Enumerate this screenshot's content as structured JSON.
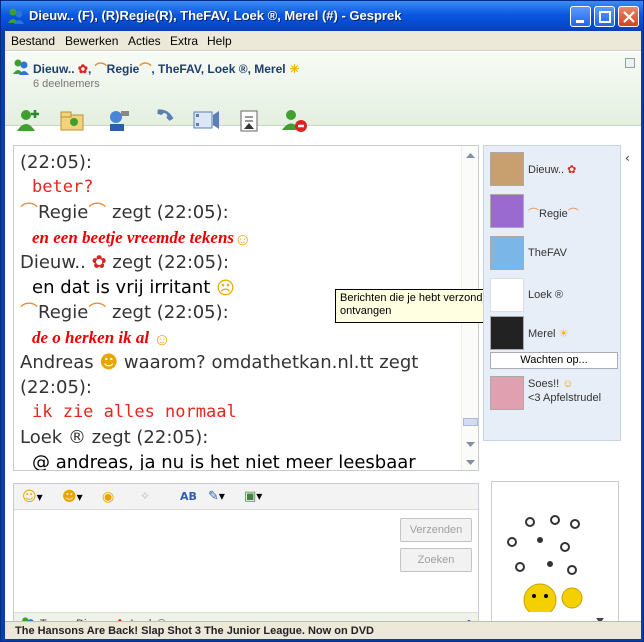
{
  "window": {
    "title": "Dieuw.. (F), (R)Regie(R), TheFAV, Loek ®, Merel (#) - Gesprek"
  },
  "menu": [
    "Bestand",
    "Bewerken",
    "Acties",
    "Extra",
    "Help"
  ],
  "participants": {
    "names_a": "Dieuw..",
    "names_b": ",",
    "names_c": "Regie",
    "names_d": ", TheFAV, Loek ®, Merel",
    "count": "6 deelnemers"
  },
  "toolbar": {
    "icons": [
      "add-contact-icon",
      "share-files-icon",
      "video-call-icon",
      "phone-icon",
      "games-icon",
      "send-picture-icon",
      "block-icon"
    ]
  },
  "chat": {
    "lines": [
      {
        "kind": "meta",
        "text": "(22:05):"
      },
      {
        "kind": "mono",
        "text": "beter?"
      },
      {
        "kind": "meta",
        "pre": "Regie",
        "text": " zegt (22:05):"
      },
      {
        "kind": "italic",
        "text": "en een beetje vreemde tekens"
      },
      {
        "kind": "meta",
        "pre": "Dieuw.. ",
        "text": " zegt (22:05):"
      },
      {
        "kind": "black",
        "text": "en dat is vrij irritant "
      },
      {
        "kind": "meta",
        "pre": "Regie",
        "text": " zegt (22:05):"
      },
      {
        "kind": "italic",
        "text": "de o herken ik al "
      },
      {
        "kind": "meta",
        "pre": "Andreas ",
        "text": " waarom? omdathetkan.nl.tt zegt"
      },
      {
        "kind": "meta",
        "text": "(22:05):"
      },
      {
        "kind": "mono",
        "text": "ik zie alles normaal"
      },
      {
        "kind": "meta",
        "text": "Loek ® zegt (22:05):"
      },
      {
        "kind": "black",
        "text": "@ andreas, ja nu is het niet meer leesbaar"
      }
    ]
  },
  "tooltip": {
    "text": "Berichten die je hebt verzonden en ontvangen"
  },
  "roster": {
    "members": [
      {
        "name": "Dieuw..",
        "color": "#c8a070"
      },
      {
        "name": "Regie",
        "color": "#9a6ad0"
      },
      {
        "name": "TheFAV",
        "color": "#7bb6e8"
      },
      {
        "name": "Loek ®",
        "color": "#ffffff"
      },
      {
        "name": "Merel",
        "color": "#222222"
      }
    ],
    "waiting_label": "Wachten op...",
    "self_name": "Soes!!",
    "self_status": "<3 Apfelstrudel"
  },
  "composer": {
    "send_label": "Verzenden",
    "search_label": "Zoeken",
    "typing_label": "Typen: Dieuw..",
    "typing_label_b": ", Loek ®"
  },
  "ad": {
    "text": "The Hansons Are Back! Slap Shot 3 The Junior League. Now on DVD"
  }
}
